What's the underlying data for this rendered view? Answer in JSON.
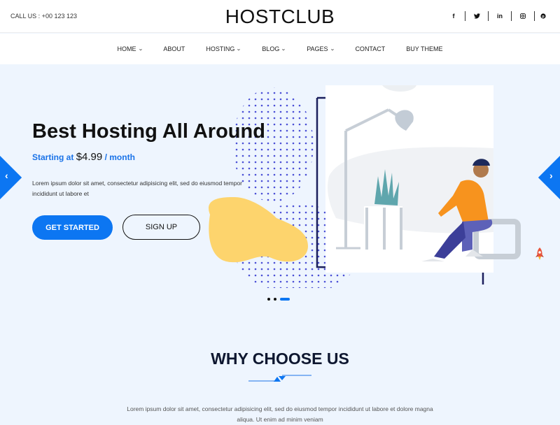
{
  "topbar": {
    "call": "CALL US : +00 123 123",
    "logo": "HOSTCLUB",
    "social": [
      {
        "icon": "facebook-icon",
        "glyph": "f"
      },
      {
        "icon": "twitter-icon",
        "glyph": "🐦"
      },
      {
        "icon": "linkedin-icon",
        "glyph": "in"
      },
      {
        "icon": "instagram-icon",
        "glyph": "◎"
      },
      {
        "icon": "pinterest-icon",
        "glyph": "℗"
      }
    ]
  },
  "nav": {
    "items": [
      {
        "label": "HOME",
        "dropdown": true
      },
      {
        "label": "ABOUT",
        "dropdown": false
      },
      {
        "label": "HOSTING",
        "dropdown": true
      },
      {
        "label": "BLOG",
        "dropdown": true
      },
      {
        "label": "PAGES",
        "dropdown": true
      },
      {
        "label": "CONTACT",
        "dropdown": false
      },
      {
        "label": "BUY THEME",
        "dropdown": false
      }
    ],
    "chevron": "⌄"
  },
  "hero": {
    "title": "Best Hosting All Around",
    "price_prefix": "Starting at",
    "price_amount": "$4.99",
    "price_suffix": "/ month",
    "description": "Lorem ipsum dolor sit amet, consectetur adipisicing elit, sed do eiusmod tempor incididunt ut labore et",
    "primary_button": "GET STARTED",
    "secondary_button": "SIGN UP",
    "prev_glyph": "‹",
    "next_glyph": "›",
    "slide_count": 3,
    "active_slide": 3
  },
  "why": {
    "title": "WHY CHOOSE US",
    "text": "Lorem ipsum dolor sit amet, consectetur adipisicing elit, sed do eiusmod tempor incididunt ut labore et dolore magna aliqua. Ut enim ad minim veniam"
  },
  "colors": {
    "accent": "#0c76f2",
    "background": "#eef5fe",
    "heading": "#0e1730"
  }
}
